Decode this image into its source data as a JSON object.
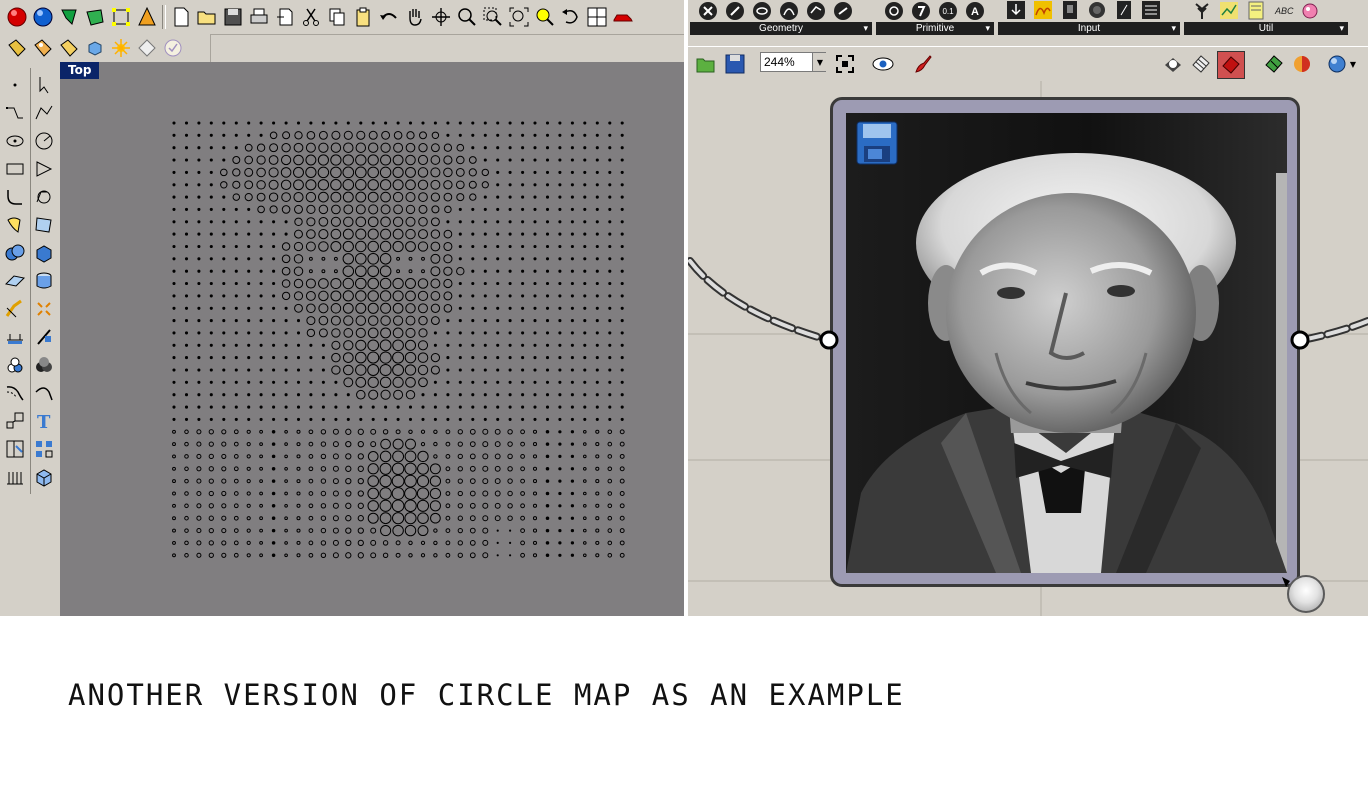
{
  "rhino": {
    "viewport_label": "Top",
    "top_toolbar_icons": [
      "sphere-red-icon",
      "sphere-blue-icon",
      "polysurface-green-icon",
      "box-green-icon",
      "control-points-icon",
      "cone-icon",
      "new-file-icon",
      "open-folder-icon",
      "save-icon",
      "print-icon",
      "import-icon",
      "cut-icon",
      "copy-icon",
      "paste-icon",
      "undo-icon",
      "pan-hand-icon",
      "rotate-view-icon",
      "zoom-icon",
      "zoom-window-icon",
      "zoom-extents-icon",
      "zoom-selected-icon",
      "undo-view-icon",
      "four-viewports-icon",
      "car-icon"
    ],
    "second_toolbar_icons": [
      "tag-layer-icon",
      "tag-properties-icon",
      "tag-render-icon",
      "render-cube-icon",
      "light-icon",
      "analysis-icon",
      "check-icon"
    ],
    "side_toolbar_icons": [
      "point-icon",
      "select-arrow-icon",
      "polyline-icon",
      "curve-icon",
      "ellipse-icon",
      "circle-icon",
      "rectangle-icon",
      "polygon-icon",
      "fillet-icon",
      "arc-icon",
      "extrude-icon",
      "surface-icon",
      "solid-union-icon",
      "box-icon",
      "plane-icon",
      "cylinder-icon",
      "trim-icon",
      "explode-icon",
      "dimension-icon",
      "split-icon",
      "boolean-icon",
      "mesh-icon",
      "offset-icon",
      "blend-icon",
      "scale-icon",
      "text-icon",
      "layout-icon",
      "array-icon",
      "grid-icon",
      "block-icon"
    ]
  },
  "grasshopper": {
    "tab_groups": [
      {
        "label": "Geometry"
      },
      {
        "label": "Primitive"
      },
      {
        "label": "Input"
      },
      {
        "label": "Util"
      }
    ],
    "primitive_icon_text": [
      "0.1",
      "A"
    ],
    "zoom_level": "244%",
    "toolbar_icons": [
      "open-file-icon",
      "save-file-icon",
      "zoom-extents-icon",
      "preview-eye-icon",
      "paintbrush-icon",
      "preview-shaded-icon",
      "preview-wire-icon",
      "preview-selected-icon",
      "bake-icon",
      "color-sphere-icon",
      "render-sphere-icon"
    ],
    "image_panel": {
      "save_button": "save-icon",
      "image_subject": "portrait-photo"
    }
  },
  "caption": "ANOTHER VERSION OF CIRCLE MAP AS AN EXAMPLE",
  "colors": {
    "toolbar_bg": "#d4d0c8",
    "viewport_bg": "#807e80",
    "viewport_label_bg": "#0a2468",
    "panel_border": "#3a3a3a"
  }
}
